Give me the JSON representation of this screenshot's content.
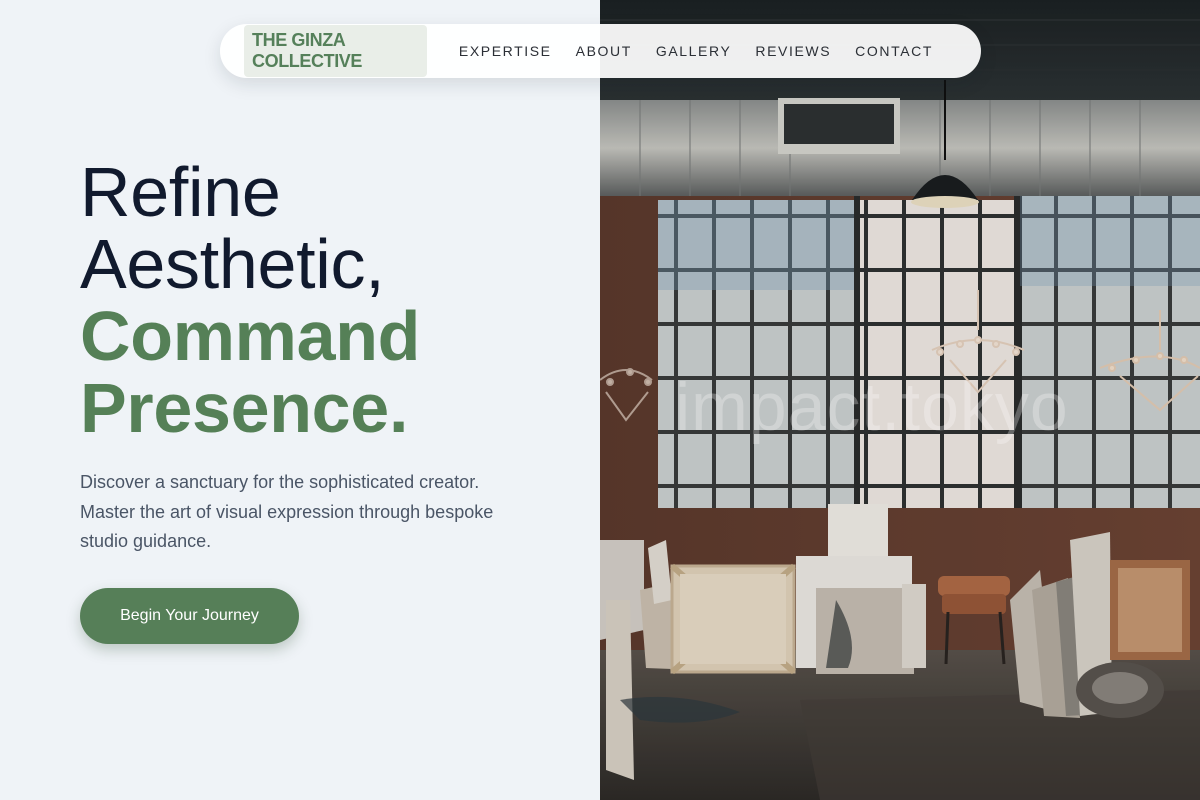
{
  "nav": {
    "brand": "THE GINZA COLLECTIVE",
    "links": [
      "EXPERTISE",
      "ABOUT",
      "GALLERY",
      "REVIEWS",
      "CONTACT"
    ]
  },
  "hero": {
    "headline_line1": "Refine",
    "headline_line2": "Aesthetic,",
    "headline_line3": "Command",
    "headline_line4": "Presence.",
    "subtext": "Discover a sanctuary for the sophisticated creator. Master the art of visual expression through bespoke studio guidance.",
    "cta_label": "Begin Your Journey"
  },
  "image": {
    "watermark": "impact.tokyo",
    "description_icon": "studio-loft-photo"
  },
  "colors": {
    "accent_green": "#567f58",
    "headline_dark": "#111a2e",
    "background": "#eff3f7"
  }
}
